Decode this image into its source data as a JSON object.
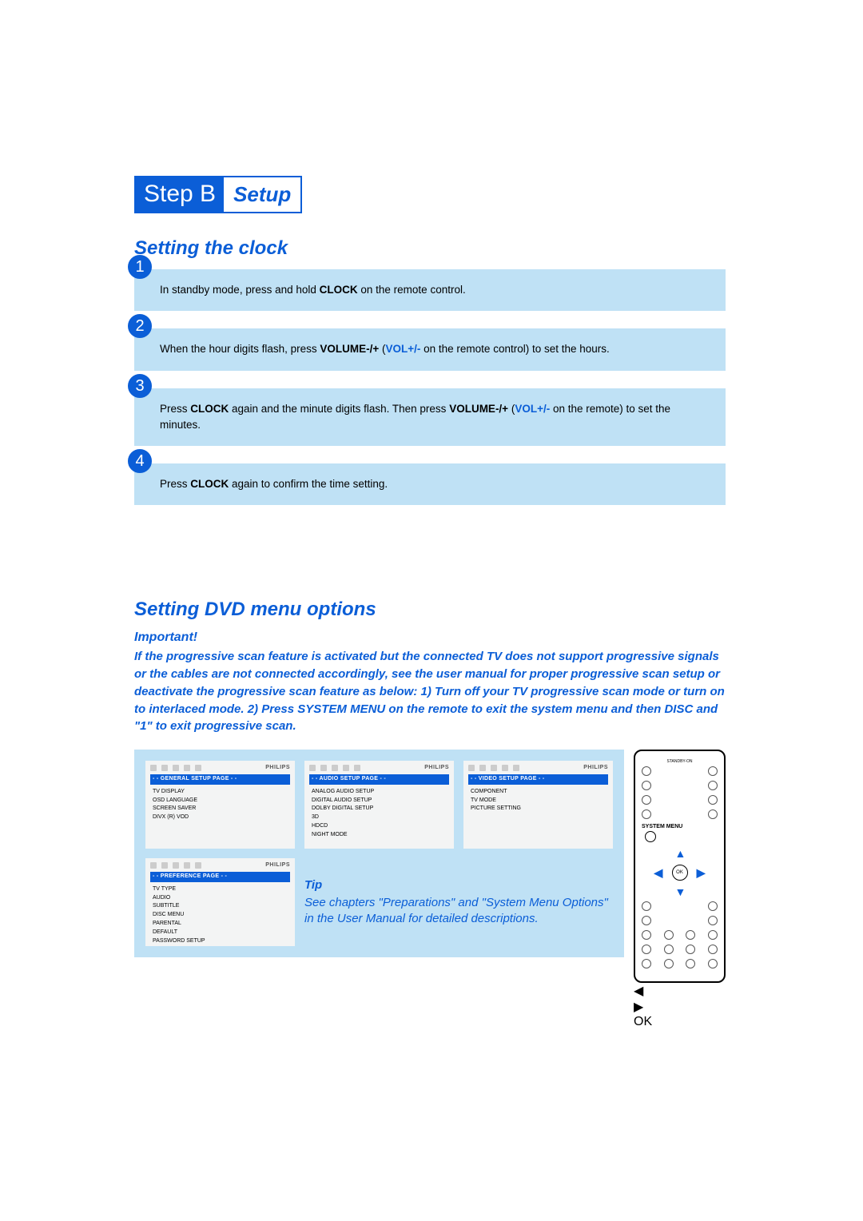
{
  "step": {
    "letter": "Step B",
    "name": "Setup"
  },
  "section1": {
    "title": "Setting the clock",
    "steps": [
      {
        "pre": "In standby mode, press and hold ",
        "kw1": "CLOCK",
        "post": " on the remote control."
      },
      {
        "pre": "When the hour digits flash, press ",
        "kw1": "VOLUME-/+",
        "mid": " (",
        "kw2": "VOL+/-",
        "post": " on the remote control) to set the hours."
      },
      {
        "pre": "Press ",
        "kw1": "CLOCK",
        "mid": " again and the minute digits flash. Then press ",
        "kw2": "VOLUME-/+",
        "mid2": " (",
        "kw3": "VOL+/-",
        "post": " on the remote) to set the minutes."
      },
      {
        "pre": "Press ",
        "kw1": "CLOCK",
        "post": " again to confirm the time setting."
      }
    ]
  },
  "section2": {
    "title": "Setting DVD menu options",
    "important_label": "Important!",
    "important_body": "If the progressive scan feature is activated but the connected TV does not support progressive signals or the cables are not connected accordingly, see the user manual for proper progressive scan setup or deactivate the progressive scan feature as below:\n1) Turn off your TV progressive scan mode or turn on to interlaced mode.\n2) Press SYSTEM MENU on the remote to exit the system menu and then DISC and \"1\" to exit progressive scan."
  },
  "menus": {
    "brand": "PHILIPS",
    "general": {
      "bar": "- - GENERAL SETUP PAGE - -",
      "items": [
        "TV DISPLAY",
        "OSD LANGUAGE",
        "SCREEN SAVER",
        "DIVX (R) VOD"
      ]
    },
    "audio": {
      "bar": "- - AUDIO SETUP PAGE - -",
      "items": [
        "ANALOG AUDIO SETUP",
        "DIGITAL AUDIO SETUP",
        "DOLBY DIGITAL SETUP",
        "3D",
        "HDCD",
        "NIGHT MODE"
      ]
    },
    "video": {
      "bar": "- - VIDEO SETUP PAGE - -",
      "items": [
        "COMPONENT",
        "TV MODE",
        "PICTURE SETTING"
      ]
    },
    "pref": {
      "bar": "- - PREFERENCE PAGE - -",
      "items": [
        "TV TYPE",
        "AUDIO",
        "SUBTITLE",
        "DISC MENU",
        "PARENTAL",
        "DEFAULT",
        "PASSWORD SETUP"
      ]
    }
  },
  "tip": {
    "head": "Tip",
    "body": "See chapters \"Preparations\" and \"System Menu Options\" in the User Manual for detailed descriptions."
  },
  "remote": {
    "topLabel": "STANDBY-ON",
    "sysmenu": "SYSTEM MENU",
    "ok": "OK"
  }
}
